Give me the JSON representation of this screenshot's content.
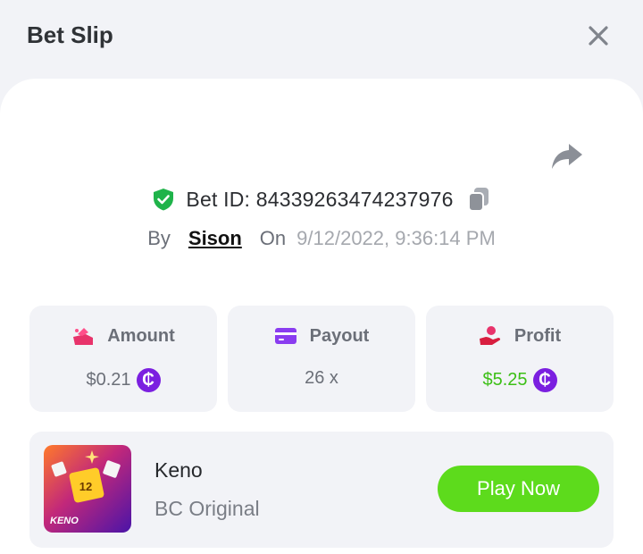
{
  "header": {
    "title": "Bet Slip"
  },
  "bet": {
    "id_text": "Bet ID: 84339263474237976",
    "by_label": "By",
    "username": "Sison",
    "on_label": "On",
    "datetime": "9/12/2022, 9:36:14 PM"
  },
  "stats": {
    "amount": {
      "label": "Amount",
      "value": "$0.21",
      "coin_symbol": "₵"
    },
    "payout": {
      "label": "Payout",
      "value": "26 x"
    },
    "profit": {
      "label": "Profit",
      "value": "$5.25",
      "coin_symbol": "₵"
    }
  },
  "game": {
    "name": "Keno",
    "provider": "BC Original",
    "thumb_label": "KENO",
    "thumb_number": "12",
    "play_label": "Play Now"
  },
  "colors": {
    "accent_green": "#5ddb1c",
    "profit_green": "#3cbf16",
    "coin_purple": "#7b1fe0",
    "panel_bg": "#f2f3f7"
  },
  "icons": {
    "close": "close-icon",
    "share": "share-icon",
    "verified": "shield-check-icon",
    "copy": "copy-icon",
    "amount": "coins-icon",
    "payout": "credit-card-icon",
    "profit": "hand-coin-icon"
  }
}
